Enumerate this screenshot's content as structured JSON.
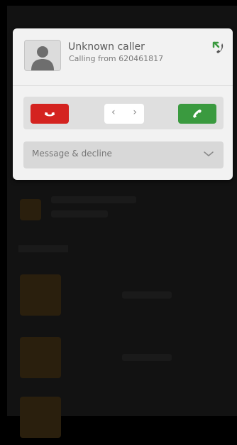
{
  "call": {
    "caller_name": "Unknown caller",
    "caller_subtitle": "Calling from 620461817"
  },
  "actions": {
    "decline_icon": "hang-up-icon",
    "accept_icon": "phone-icon",
    "slider_icon": "left-right-chevrons-icon"
  },
  "reply": {
    "label": "Message & decline",
    "icon": "chevron-down-icon"
  },
  "colors": {
    "decline": "#d42320",
    "accept": "#3a9a3f",
    "incoming": "#3a9a3f"
  }
}
